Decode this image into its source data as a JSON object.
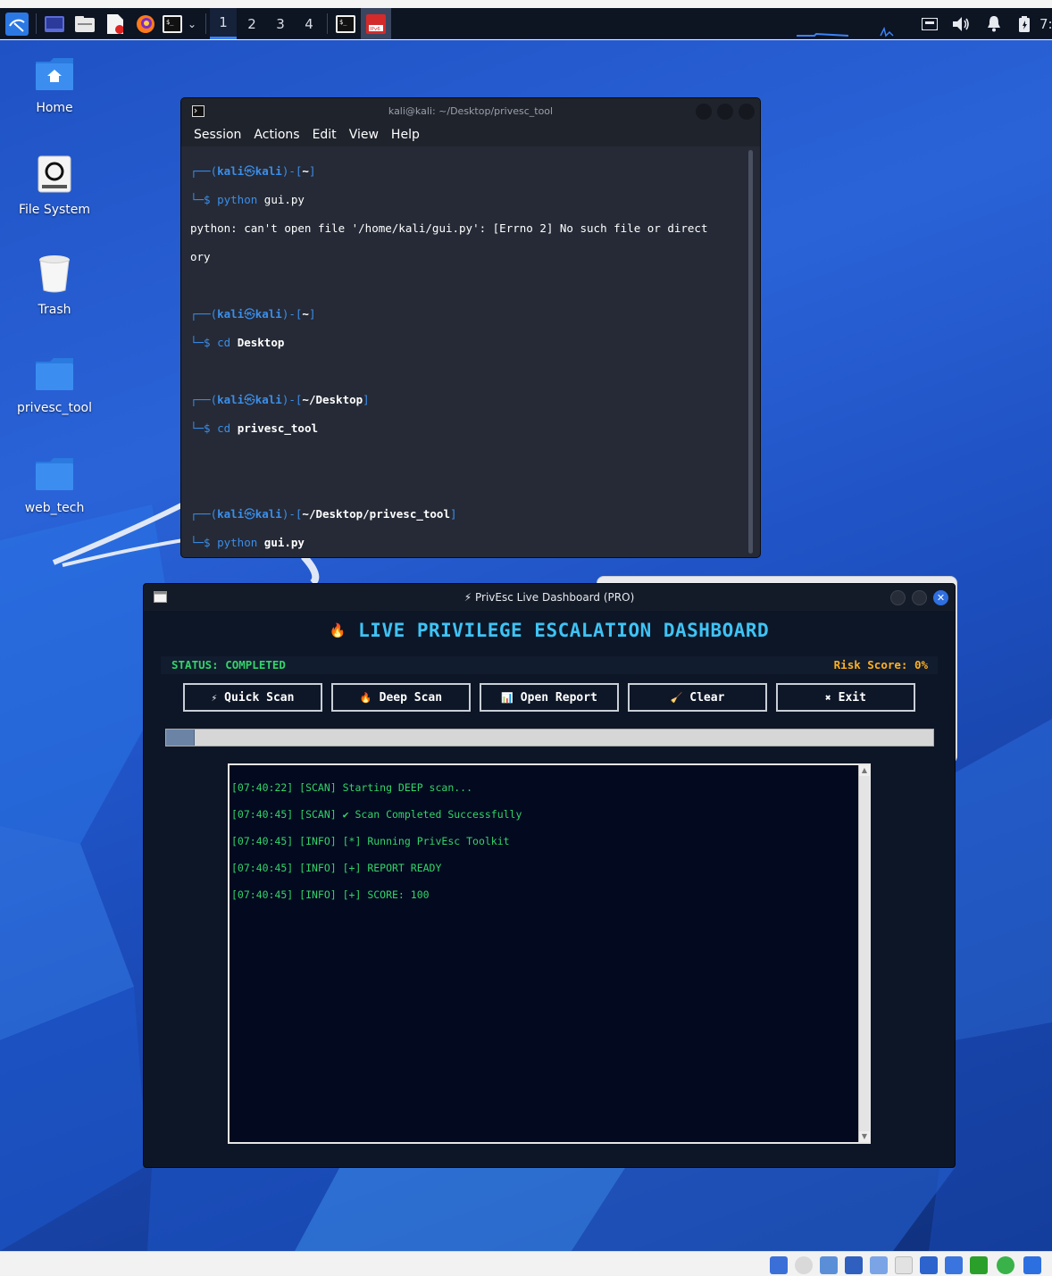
{
  "panel": {
    "workspaces": [
      "1",
      "2",
      "3",
      "4"
    ],
    "active_workspace": "1",
    "clock_partial": "7:"
  },
  "desktop": {
    "icons": [
      {
        "label": "Home",
        "icon": "home-folder-icon"
      },
      {
        "label": "File System",
        "icon": "drive-icon"
      },
      {
        "label": "Trash",
        "icon": "trash-icon"
      },
      {
        "label": "privesc_tool",
        "icon": "folder-icon"
      },
      {
        "label": "web_tech",
        "icon": "folder-icon"
      }
    ]
  },
  "terminal": {
    "title": "kali@kali: ~/Desktop/privesc_tool",
    "menu": [
      "Session",
      "Actions",
      "Edit",
      "View",
      "Help"
    ],
    "lines": {
      "p1_user": "kali",
      "p1_at": "㉿",
      "p1_host": "kali",
      "p1_dir": "~",
      "cmd1_name": "python",
      "cmd1_arg": "gui.py",
      "err1": "python: can't open file '/home/kali/gui.py': [Errno 2] No such file or direct",
      "err2": "ory",
      "p2_dir": "~",
      "cmd2_name": "cd",
      "cmd2_arg": "Desktop",
      "p3_dir": "~/Desktop",
      "cmd3_name": "cd",
      "cmd3_arg": "privesc_tool",
      "p4_dir": "~/Desktop/privesc_tool",
      "cmd4_name": "python",
      "cmd4_arg": "gui.py"
    }
  },
  "dashboard": {
    "title": "⚡ PrivEsc Live Dashboard (PRO)",
    "heading_icon": "🔥",
    "heading": "LIVE PRIVILEGE ESCALATION DASHBOARD",
    "status": "STATUS: COMPLETED",
    "risk": "Risk Score: 0%",
    "buttons": [
      {
        "icon": "⚡",
        "label": "Quick Scan"
      },
      {
        "icon": "🔥",
        "label": "Deep Scan"
      },
      {
        "icon": "📊",
        "label": "Open Report"
      },
      {
        "icon": "🧹",
        "label": "Clear"
      },
      {
        "icon": "✖",
        "label": "Exit"
      }
    ],
    "progress_fraction": 0.037,
    "log": [
      "[07:40:22] [SCAN] Starting DEEP scan...",
      "[07:40:45] [SCAN] ✔ Scan Completed Successfully",
      "[07:40:45] [INFO] [*] Running PrivEsc Toolkit",
      "[07:40:45] [INFO] [+] REPORT READY",
      "[07:40:45] [INFO] [+] SCORE: 100"
    ]
  },
  "colors": {
    "accent": "#3ec3f5",
    "status_green": "#34d36a",
    "risk_orange": "#ffb020",
    "prompt_blue": "#3b8eea"
  }
}
